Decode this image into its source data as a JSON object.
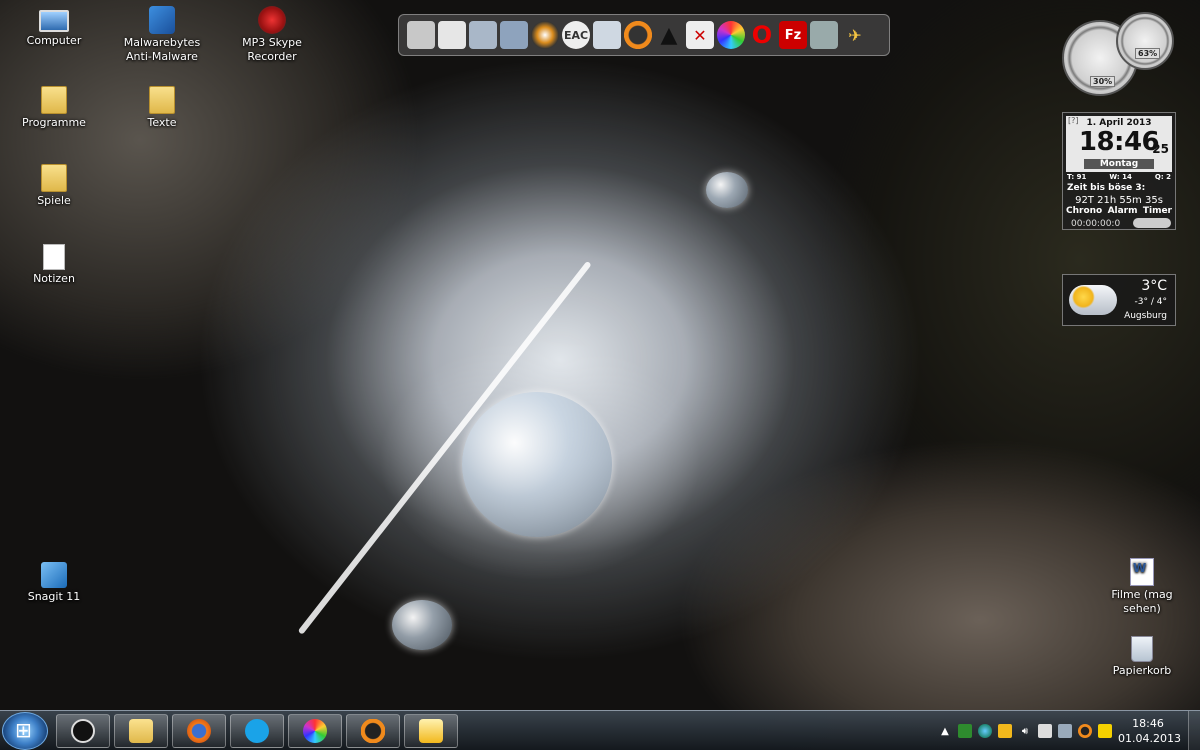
{
  "desktop_icons": [
    {
      "label": "Computer",
      "icon": "computer-icon"
    },
    {
      "label": "Malwarebytes Anti-Malware",
      "line1": "Malwarebytes",
      "line2": "Anti-Malware",
      "icon": "malwarebytes-icon"
    },
    {
      "label": "MP3 Skype Recorder",
      "icon": "mp3-skype-recorder-icon"
    },
    {
      "label": "Programme",
      "icon": "folder-icon"
    },
    {
      "label": "Texte",
      "icon": "folder-icon"
    },
    {
      "label": "Spiele",
      "icon": "folder-icon"
    },
    {
      "label": "Notizen",
      "icon": "text-document-icon"
    },
    {
      "label": "Snagit 11",
      "icon": "snagit-icon"
    },
    {
      "label": "Filme (mag sehen)",
      "icon": "word-document-icon"
    },
    {
      "label": "Papierkorb",
      "icon": "recycle-bin-icon"
    }
  ],
  "quick_launch": {
    "eac_label": "EAC",
    "icons": [
      "unknown-app-icon",
      "notepad-icon",
      "window-icon",
      "window-icon",
      "disc-burner-icon",
      "eac-icon",
      "cd-ripper-icon",
      "orange-ring-icon",
      "black-arrow-icon",
      "x-tool-icon",
      "color-ball-icon",
      "opera-icon",
      "filezilla-icon",
      "utility-icon",
      "jet-icon"
    ],
    "filezilla_label": "Fz"
  },
  "gauges": {
    "cpu_percent": "30%",
    "memory_percent": "63%"
  },
  "clock_gadget": {
    "corner": "[?]",
    "date": "1. April 2013",
    "time": "18:46",
    "seconds": "25",
    "day": "Montag",
    "meta_t": "T: 91",
    "meta_w": "W: 14",
    "meta_q": "Q: 2",
    "countdown_label": "Zeit bis böse 3:",
    "countdown": "92T 21h 55m 35s",
    "tabs": [
      "Chrono",
      "Alarm",
      "Timer"
    ],
    "chrono": "00:00:00:0"
  },
  "weather_gadget": {
    "temp": "3°C",
    "range": "-3° / 4°",
    "city": "Augsburg"
  },
  "taskbar": {
    "pinned": [
      "foobar-icon",
      "explorer-folder-icon",
      "firefox-icon",
      "skype-icon",
      "color-ball-icon",
      "orange-ring-icon",
      "mail-icon"
    ],
    "time": "18:46",
    "date": "01.04.2013",
    "tray_expand": "▲"
  },
  "colors": {
    "taskbar": "#1e252c",
    "accent": "#3d7fc7"
  }
}
